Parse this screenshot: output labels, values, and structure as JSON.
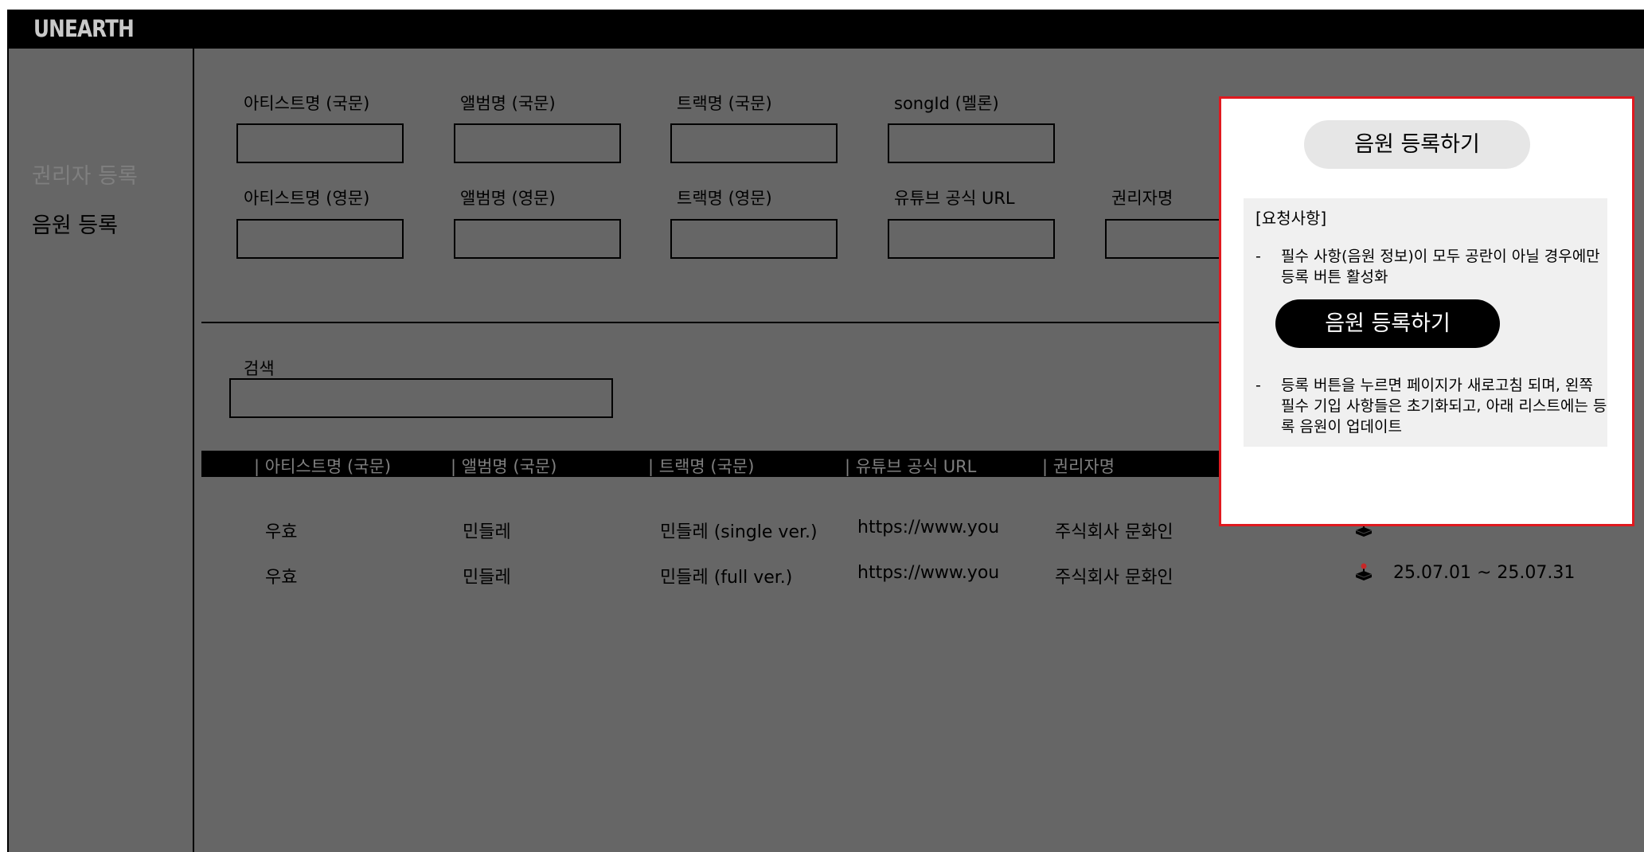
{
  "app": {
    "logo": "UNEARTH"
  },
  "sidebar": {
    "items": [
      {
        "label": "권리자 등록"
      },
      {
        "label": "음원 등록"
      }
    ]
  },
  "form": {
    "row1": [
      {
        "label": "아티스트명 (국문)"
      },
      {
        "label": "앨범명 (국문)"
      },
      {
        "label": "트랙명 (국문)"
      },
      {
        "label": "songId (멜론)"
      }
    ],
    "row2": [
      {
        "label": "아티스트명 (영문)"
      },
      {
        "label": "앨범명 (영문)"
      },
      {
        "label": "트랙명 (영문)"
      },
      {
        "label": "유튜브 공식 URL"
      },
      {
        "label": "권리자명"
      }
    ],
    "search_label": "검색"
  },
  "table": {
    "headers": [
      "| 아티스트명 (국문)",
      "| 앨범명 (국문)",
      "| 트랙명 (국문)",
      "| 유튜브 공식 URL",
      "| 권리자명"
    ],
    "rows": [
      {
        "artist": "우효",
        "album": "민들레",
        "track": "민들레 (single ver.)",
        "url": "https://www.you",
        "owner": "주식회사 문화인",
        "period": ""
      },
      {
        "artist": "우효",
        "album": "민들레",
        "track": "민들레 (full ver.)",
        "url": "https://www.you",
        "owner": "주식회사 문화인",
        "period": "25.07.01 ~ 25.07.31"
      }
    ]
  },
  "modal": {
    "register_button": "음원 등록하기",
    "notes_title": "[요청사항]",
    "note_dash": "-",
    "note1": "필수 사항(음원 정보)이 모두 공란이 아닐 경우에만 등록 버튼 활성화",
    "active_button": "음원 등록하기",
    "note2": "등록 버튼을 누르면 페이지가 새로고침 되며, 왼쪽 필수 기입 사항들은 초기화되고, 아래 리스트에는 등록 음원이 업데이트"
  },
  "colors": {
    "overlay": "#666666",
    "modal_border": "#e0191f",
    "header_text": "#7f7f7f"
  },
  "icons": {
    "row_action": "joystick-icon"
  }
}
